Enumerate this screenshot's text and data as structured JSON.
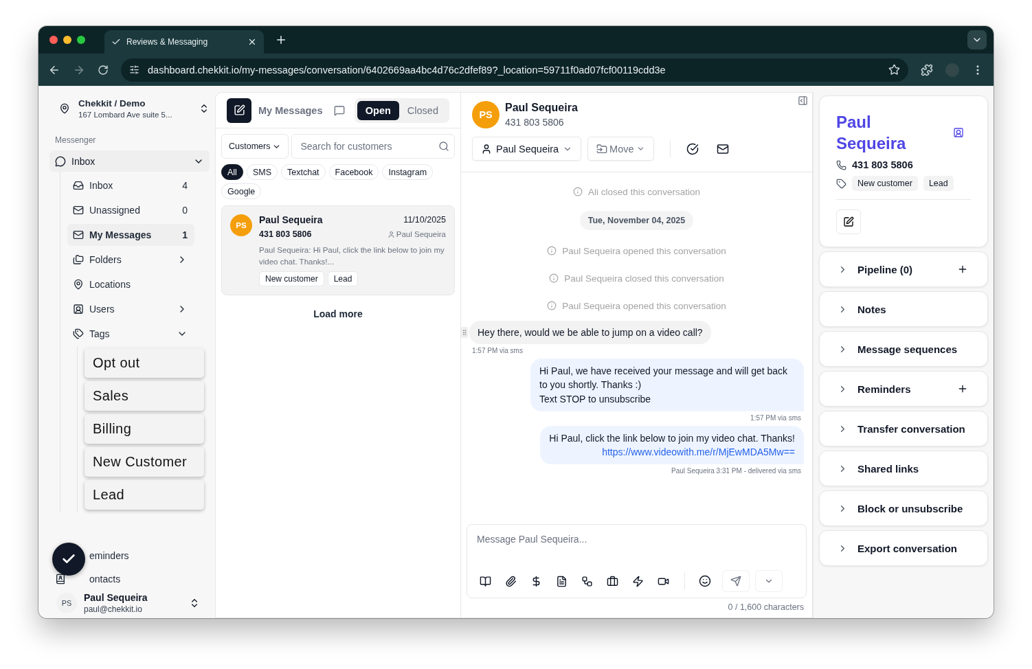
{
  "browser": {
    "tab_title": "Reviews & Messaging",
    "url": "dashboard.chekkit.io/my-messages/conversation/6402669aa4bc4d76c2dfef89?_location=59711f0ad07fcf00119cdd3e"
  },
  "sidebar": {
    "org": {
      "name": "Chekkit / Demo",
      "address": "167 Lombard Ave suite 5..."
    },
    "section_label": "Messenger",
    "group": {
      "label": "Inbox",
      "expanded": true
    },
    "items": [
      {
        "label": "Inbox",
        "kind": "count",
        "count": "4",
        "selected": false
      },
      {
        "label": "Unassigned",
        "kind": "count",
        "count": "0",
        "selected": false
      },
      {
        "label": "My Messages",
        "kind": "count",
        "count": "1",
        "selected": true
      },
      {
        "label": "Folders",
        "kind": "submenu",
        "selected": false
      },
      {
        "label": "Locations",
        "kind": "plain",
        "selected": false
      },
      {
        "label": "Users",
        "kind": "submenu",
        "selected": false
      },
      {
        "label": "Tags",
        "kind": "expand",
        "selected": false
      }
    ],
    "tags": [
      "Opt out",
      "Sales",
      "Billing",
      "New Customer",
      "Lead"
    ],
    "bottom_items": [
      "eminders",
      "ontacts"
    ],
    "user": {
      "initials": "PS",
      "name": "Paul Sequeira",
      "email": "paul@chekkit.io"
    }
  },
  "list": {
    "title": "My Messages",
    "statuses": [
      {
        "label": "Open",
        "selected": true
      },
      {
        "label": "Closed",
        "selected": false
      }
    ],
    "filter_label": "Customers",
    "search_placeholder": "Search for customers",
    "channels": [
      {
        "label": "All",
        "selected": true
      },
      {
        "label": "SMS",
        "selected": false
      },
      {
        "label": "Textchat",
        "selected": false
      },
      {
        "label": "Facebook",
        "selected": false
      },
      {
        "label": "Instagram",
        "selected": false
      },
      {
        "label": "Google",
        "selected": false
      }
    ],
    "conversations": [
      {
        "initials": "PS",
        "name": "Paul Sequeira",
        "date": "11/10/2025",
        "phone": "431 803 5806",
        "assignee": "Paul Sequeira",
        "preview": "Paul Sequeira: Hi Paul, click the link below to join my video chat. Thanks!...",
        "tags": [
          "New customer",
          "Lead"
        ],
        "selected": true
      }
    ],
    "load_more": "Load more"
  },
  "chat": {
    "initials": "PS",
    "name": "Paul Sequeira",
    "phone": "431 803 5806",
    "assignee": "Paul Sequeira",
    "move_label": "Move",
    "events": [
      {
        "kind": "system",
        "text": "Ali closed this conversation"
      },
      {
        "kind": "date",
        "text": "Tue, November 04, 2025"
      },
      {
        "kind": "system",
        "text": "Paul Sequeira opened this conversation"
      },
      {
        "kind": "system",
        "text": "Paul Sequeira closed this conversation"
      },
      {
        "kind": "system",
        "text": "Paul Sequeira opened this conversation"
      },
      {
        "kind": "incoming",
        "text": "Hey there, would we be able to jump on a video call?",
        "meta": "1:57 PM via sms"
      },
      {
        "kind": "outgoing",
        "text": "Hi Paul, we have received your message and will get back to you shortly. Thanks :)\nText STOP to unsubscribe",
        "meta": "1:57 PM via sms"
      },
      {
        "kind": "outgoing",
        "text": "Hi Paul, click the link below to join my video chat. Thanks!",
        "link": "https://www.videowith.me/r/MjEwMDA5Mw==",
        "meta": "Paul Sequeira 3:31 PM - delivered via sms"
      }
    ],
    "composer": {
      "placeholder": "Message Paul Sequeira...",
      "counter": "0 / 1,600 characters"
    }
  },
  "contact": {
    "name": "Paul Sequeira",
    "phone": "431 803 5806",
    "tags": [
      "New customer",
      "Lead"
    ],
    "sections": [
      {
        "label": "Pipeline (0)",
        "addable": true
      },
      {
        "label": "Notes",
        "addable": false
      },
      {
        "label": "Message sequences",
        "addable": false
      },
      {
        "label": "Reminders",
        "addable": true
      },
      {
        "label": "Transfer conversation",
        "addable": false
      },
      {
        "label": "Shared links",
        "addable": false
      },
      {
        "label": "Block or unsubscribe",
        "addable": false
      },
      {
        "label": "Export conversation",
        "addable": false
      }
    ]
  }
}
